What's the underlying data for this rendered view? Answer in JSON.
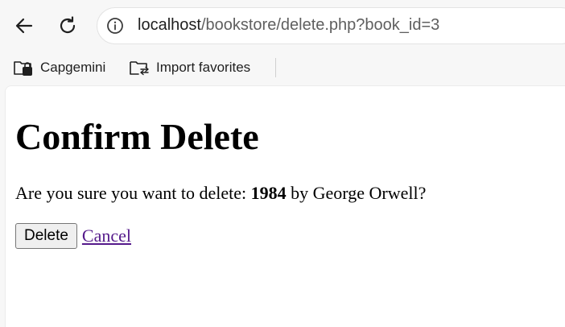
{
  "browser": {
    "url_host": "localhost",
    "url_rest": "/bookstore/delete.php?book_id=3",
    "bookmarks": [
      {
        "label": "Capgemini",
        "icon": "folder-icon"
      },
      {
        "label": "Import favorites",
        "icon": "import-folder-icon"
      }
    ]
  },
  "page": {
    "title": "Confirm Delete",
    "question_prefix": "Are you sure you want to delete: ",
    "book_title": "1984",
    "question_by": " by ",
    "author": "George Orwell",
    "question_suffix": "?",
    "delete_label": "Delete",
    "cancel_label": "Cancel"
  },
  "colors": {
    "link_visited": "#551a8b",
    "toolbar_bg": "#f7f7f7"
  }
}
